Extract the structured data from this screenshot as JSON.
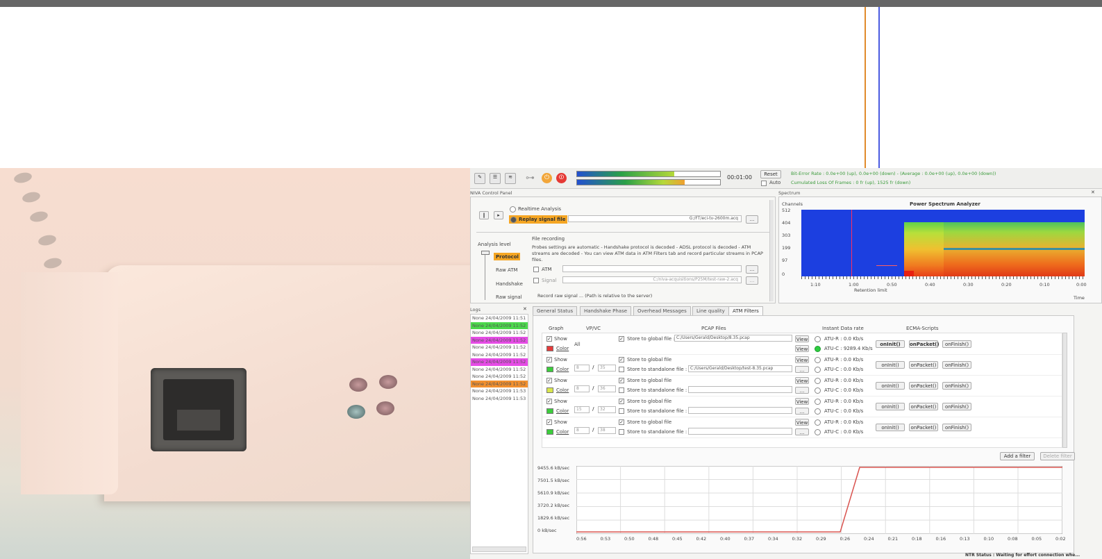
{
  "app": {
    "timer": "00:01:00",
    "reset_label": "Reset",
    "auto_label": "Auto",
    "status_line1": "Bit-Error Rate : 0.0e+00 (up), 0.0e+00 (down) - (Average : 0.0e+00 (up), 0.0e+00 (down))",
    "status_line2": "Cumulated Loss Of Frames : 0 fr (up), 1525 fr (down)",
    "levels": [
      0.68,
      0.75
    ],
    "colors": {
      "accent": "#f5a623",
      "protocol": "#f5a623"
    }
  },
  "control_panel": {
    "title": "NIVA Control Panel",
    "realtime_label": "Realtime Analysis",
    "replay_label": "Replay signal file",
    "replay_path": "G:/FT/eci-tv-2600m.acq",
    "browse": "...",
    "analysis_level_label": "Analysis level",
    "levels": [
      "Protocol",
      "Raw ATM",
      "Handshake",
      "Raw signal"
    ],
    "file_recording_label": "File recording",
    "recording_text": "Probes settings are automatic - Handshake protocol is decoded - ADSL protocol is decoded - ATM streams are decoded - You can view ATM data in ATM Filters tab and record particular streams in PCAP files.",
    "atm_label": "ATM",
    "signal_label": "Signal",
    "signal_path": "C:/niva-acquisitions/P25M/test-raw-2.acq",
    "raw_signal_note": "Record raw signal ... (Path is relative to the server)"
  },
  "spectrum": {
    "title": "Spectrum",
    "chart_title": "Power Spectrum Analyzer",
    "channels_label": "Channels",
    "y_ticks": [
      "512",
      "404",
      "303",
      "199",
      "97",
      "0"
    ],
    "x_ticks": [
      "1:10",
      "1:00",
      "0:50",
      "0:40",
      "0:30",
      "0:20",
      "0:10",
      "0:00"
    ],
    "retention_label": "Retention limit",
    "time_label": "Time"
  },
  "logs": {
    "title": "Logs",
    "lines": [
      {
        "text": "None 24/04/2009 11:51",
        "bg": ""
      },
      {
        "text": "None 24/04/2009 11:52",
        "bg": "#4cd94c"
      },
      {
        "text": "None 24/04/2009 11:52",
        "bg": ""
      },
      {
        "text": "None 24/04/2009 11:52",
        "bg": "#e64ce6"
      },
      {
        "text": "None 24/04/2009 11:52",
        "bg": ""
      },
      {
        "text": "None 24/04/2009 11:52",
        "bg": ""
      },
      {
        "text": "None 24/04/2009 11:52",
        "bg": "#e64ce6"
      },
      {
        "text": "None 24/04/2009 11:52",
        "bg": ""
      },
      {
        "text": "None 24/04/2009 11:52",
        "bg": ""
      },
      {
        "text": "None 24/04/2009 11:52",
        "bg": "#f2902e"
      },
      {
        "text": "None 24/04/2009 11:53",
        "bg": ""
      },
      {
        "text": "None 24/04/2009 11:53",
        "bg": ""
      }
    ]
  },
  "tabs": [
    "General Status",
    "Handshake Phase",
    "Overhead Messages",
    "Line quality",
    "ATM Filters"
  ],
  "filters": {
    "headers": {
      "graph": "Graph",
      "vpvc": "VP/VC",
      "pcap": "PCAP Files",
      "rate": "Instant Data rate",
      "scripts": "ECMA-Scripts"
    },
    "show": "Show",
    "color": "Color",
    "view": "View",
    "all": "All",
    "on_init": "onInit()",
    "on_packet": "onPacket()",
    "on_finish": "onFinish()",
    "rows": [
      {
        "vp": "",
        "vc": "",
        "swatch": "#e53b3b",
        "global_checked": "✓",
        "global": "Store to global file :",
        "global_path": "C:/Users/Gerald/Desktop/8.35.pcap",
        "standalone": "",
        "standalone_path": "",
        "rate_r": "ATU-R :   0.0 Kb/s",
        "rate_c": "ATU-C : 9289.4 Kb/s",
        "active": true
      },
      {
        "vp": "8",
        "vc": "35",
        "swatch": "#3ccc3c",
        "global_checked": "✓",
        "global": "Store to global file",
        "global_path": "",
        "standalone": "Store to standalone file :",
        "standalone_path": "C:/Users/Gerald/Desktop/test-8.35.pcap",
        "rate_r": "ATU-R :   0.0 Kb/s",
        "rate_c": "ATU-C :   0.0 Kb/s",
        "active": false
      },
      {
        "vp": "8",
        "vc": "36",
        "swatch": "#d9e64c",
        "global_checked": "✓",
        "global": "Store to global file",
        "global_path": "",
        "standalone": "Store to standalone file :",
        "standalone_path": "",
        "rate_r": "ATU-R :   0.0 Kb/s",
        "rate_c": "ATU-C :   0.0 Kb/s",
        "active": false
      },
      {
        "vp": "15",
        "vc": "32",
        "swatch": "#3ccc3c",
        "global_checked": "✓",
        "global": "Store to global file",
        "global_path": "",
        "standalone": "Store to standalone file :",
        "standalone_path": "",
        "rate_r": "ATU-R :   0.0 Kb/s",
        "rate_c": "ATU-C :   0.0 Kb/s",
        "active": false
      },
      {
        "vp": "8",
        "vc": "38",
        "swatch": "#3ccc3c",
        "global_checked": "✓",
        "global": "Store to global file",
        "global_path": "",
        "standalone": "Store to standalone file :",
        "standalone_path": "",
        "rate_r": "ATU-R :   0.0 Kb/s",
        "rate_c": "ATU-C :   0.0 Kb/s",
        "active": false
      }
    ],
    "add_filter": "Add a filter",
    "delete_filter": "Delete filter"
  },
  "throughput": {
    "y_ticks": [
      "9455.6 kB/sec",
      "7501.5 kB/sec",
      "5610.9 kB/sec",
      "3720.2 kB/sec",
      "1829.6 kB/sec",
      "0 kB/sec"
    ],
    "x_ticks": [
      "0:56",
      "0:53",
      "0:50",
      "0:48",
      "0:45",
      "0:42",
      "0:40",
      "0:37",
      "0:34",
      "0:32",
      "0:29",
      "0:26",
      "0:24",
      "0:21",
      "0:18",
      "0:16",
      "0:13",
      "0:10",
      "0:08",
      "0:05",
      "0:02"
    ],
    "line_color": "#d9534f"
  },
  "status_bar": "NTR Status : Waiting for effort connection whe..."
}
